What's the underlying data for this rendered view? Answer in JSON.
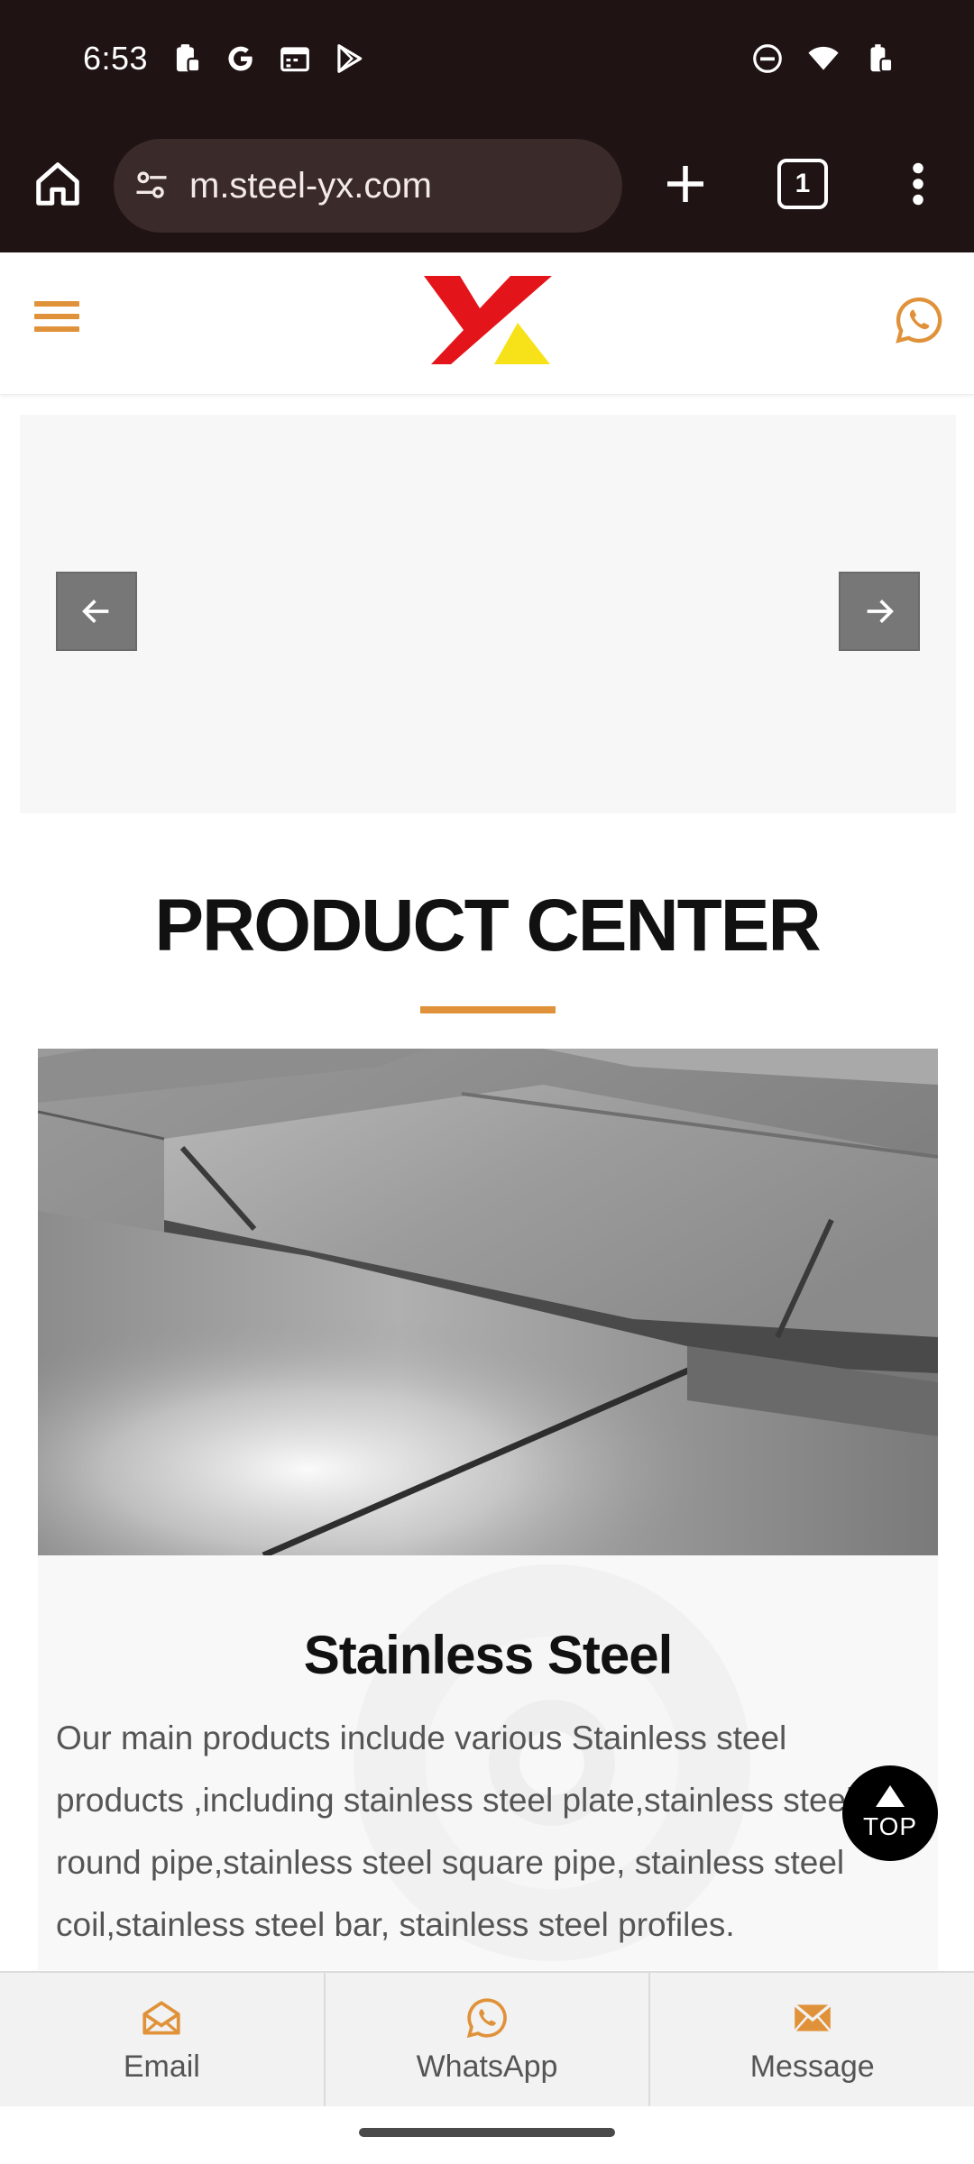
{
  "status_bar": {
    "time": "6:53",
    "left_icons": [
      "clipboard-icon",
      "google-icon",
      "calendar-icon",
      "play-store-icon"
    ],
    "right_icons": [
      "dnd-icon",
      "wifi-icon",
      "battery-icon"
    ]
  },
  "browser": {
    "url": "m.steel-yx.com",
    "tab_count": "1"
  },
  "header": {
    "logo_colors": {
      "red": "#e3151b",
      "yellow": "#f7e21a"
    },
    "accent": "#e0923a"
  },
  "section": {
    "title": "PRODUCT CENTER"
  },
  "product": {
    "name": "Stainless Steel",
    "description": "Our main products include various Stainless steel products ,including stainless steel plate,stainless steel round pipe,stainless steel square pipe, stainless steel coil,stainless steel bar, stainless steel profiles."
  },
  "top_button": {
    "label": "TOP"
  },
  "bottom_nav": {
    "items": [
      {
        "label": "Email",
        "icon": "email-open-icon"
      },
      {
        "label": "WhatsApp",
        "icon": "whatsapp-icon"
      },
      {
        "label": "Message",
        "icon": "envelope-icon"
      }
    ]
  }
}
